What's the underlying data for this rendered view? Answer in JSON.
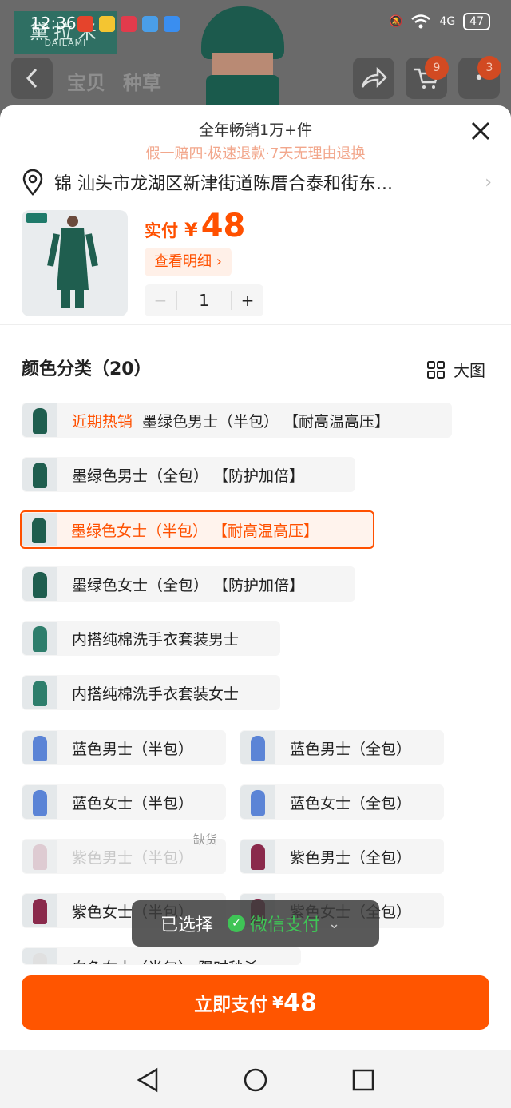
{
  "status_bar": {
    "time": "12:36",
    "network": "4G",
    "battery": "47"
  },
  "background": {
    "brand_logo_text": "DAILAMI",
    "brand_logo_hanzi": "黛拉米",
    "tabs": [
      "宝贝",
      "种草"
    ],
    "cart_badge": "9",
    "more_badge": "3"
  },
  "sheet": {
    "promo_line": "全年畅销1万+件",
    "guarantee_line": "假一赔四·极速退款·7天无理由退换",
    "address": "锦 汕头市龙湖区新津街道陈厝合泰和街东...",
    "price_label": "实付",
    "price_currency": "¥",
    "price_value": "48",
    "detail_button": "查看明细 ›",
    "quantity": {
      "minus": "−",
      "value": "1",
      "plus": "+"
    },
    "section_title": "颜色分类（20）",
    "big_view_label": "大图",
    "options": [
      {
        "hot": "近期热销",
        "label": "墨绿色男士（半包）  【耐高温高压】",
        "color": "#1f5e4f"
      },
      {
        "label": "墨绿色男士（全包）  【防护加倍】",
        "color": "#1f5e4f"
      },
      {
        "label": "墨绿色女士（半包）  【耐高温高压】",
        "color": "#1f5e4f"
      },
      {
        "label": "墨绿色女士（全包）  【防护加倍】",
        "color": "#1f5e4f"
      },
      {
        "label": "内搭纯棉洗手衣套装男士",
        "color": "#2e7e6c"
      },
      {
        "label": "内搭纯棉洗手衣套装女士",
        "color": "#2e7e6c"
      },
      {
        "label": "蓝色男士（半包）",
        "color": "#5b84d6"
      },
      {
        "label": "蓝色男士（全包）",
        "color": "#5b84d6"
      },
      {
        "label": "蓝色女士（半包）",
        "color": "#5b84d6"
      },
      {
        "label": "蓝色女士（全包）",
        "color": "#5b84d6"
      },
      {
        "label": "紫色男士（半包）",
        "color": "#8a2a4c",
        "soldout": "缺货"
      },
      {
        "label": "紫色男士（全包）",
        "color": "#8a2a4c"
      },
      {
        "label": "紫色女士（半包）",
        "color": "#8a2a4c"
      },
      {
        "label": "紫色女士（全包）",
        "color": "#8a2a4c"
      },
      {
        "label": "白色女士（半包）  限时秒杀",
        "color": "#e6e6e6"
      }
    ],
    "toast": {
      "selected_label": "已选择",
      "method": "微信支付",
      "method_icon": "wechat-pay-icon"
    },
    "pay_button": {
      "label": "立即支付",
      "currency": "¥",
      "value": "48"
    }
  },
  "colors": {
    "accent": "#ff5500",
    "price": "#ff5000",
    "wechat": "#3fc456"
  }
}
